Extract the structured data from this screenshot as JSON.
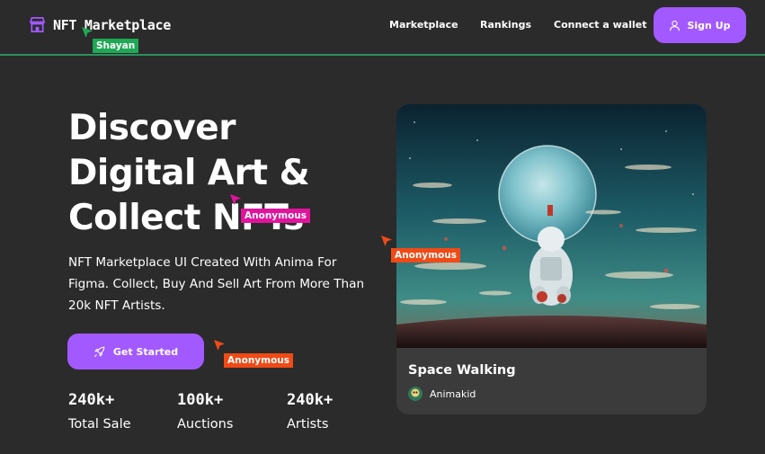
{
  "header": {
    "logo_text": "NFT Marketplace",
    "nav": [
      "Marketplace",
      "Rankings",
      "Connect a wallet"
    ],
    "signup_label": "Sign Up"
  },
  "hero": {
    "title_lines": [
      "Discover",
      "Digital Art &",
      "Collect NFTs"
    ],
    "subtitle": "NFT Marketplace UI Created With Anima For Figma. Collect, Buy And Sell Art From More Than 20k NFT Artists.",
    "cta_label": "Get Started",
    "stats": [
      {
        "value": "240k+",
        "label": "Total Sale"
      },
      {
        "value": "100k+",
        "label": "Auctions"
      },
      {
        "value": "240k+",
        "label": "Artists"
      }
    ]
  },
  "card": {
    "title": "Space Walking",
    "artist": "Animakid"
  },
  "cursors": [
    {
      "name": "Shayan",
      "color": "#1fa855"
    },
    {
      "name": "Anonymous",
      "color": "#e0149c"
    },
    {
      "name": "Anonymous",
      "color": "#f04a16"
    },
    {
      "name": "Anonymous",
      "color": "#f04a16"
    }
  ],
  "colors": {
    "background": "#2b2b2b",
    "accent": "#a259ff",
    "card": "#3b3b3b",
    "divider": "#2e8f5e"
  }
}
